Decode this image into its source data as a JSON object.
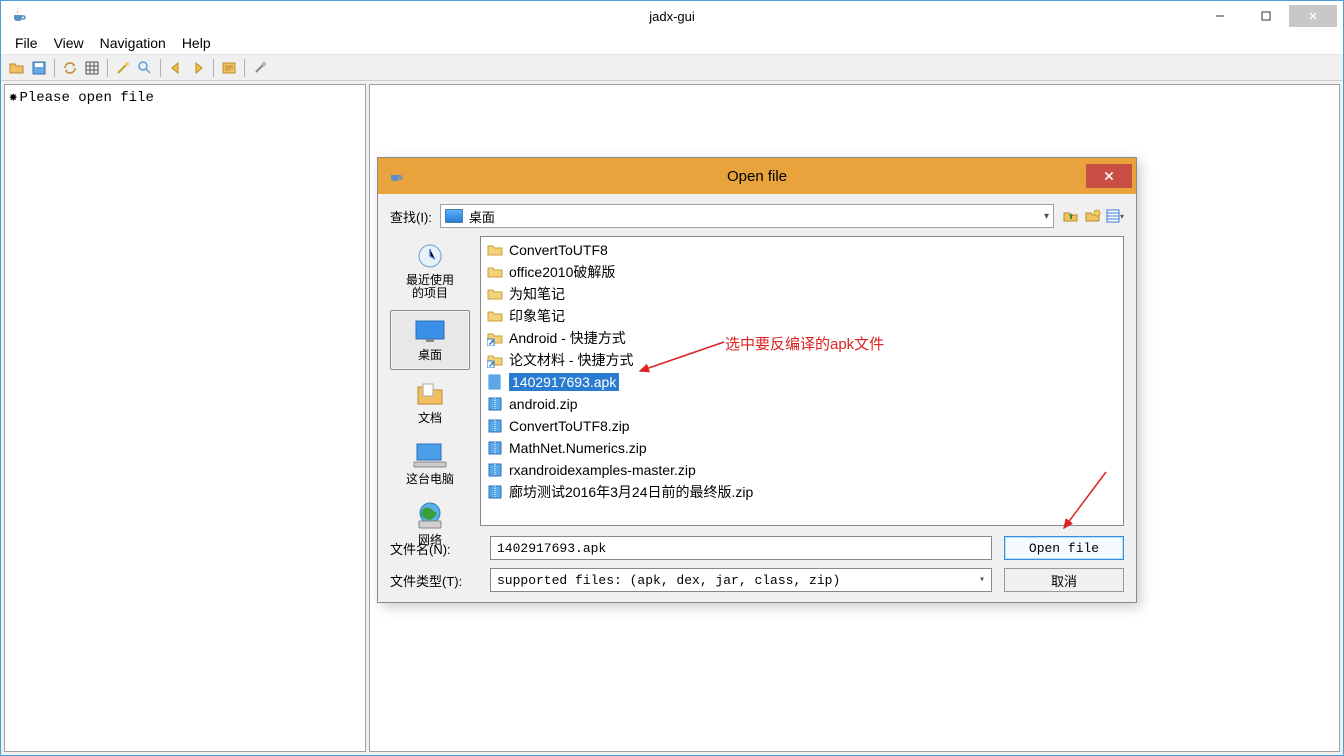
{
  "window": {
    "title": "jadx-gui"
  },
  "menu": {
    "file": "File",
    "view": "View",
    "navigation": "Navigation",
    "help": "Help"
  },
  "sidepanel": {
    "message": "Please open file"
  },
  "dialog": {
    "title": "Open file",
    "lookup_label": "查找(I):",
    "lookup_value": "桌面",
    "places": {
      "recent": "最近使用\n的项目",
      "desktop": "桌面",
      "documents": "文档",
      "computer": "这台电脑",
      "network": "网络"
    },
    "files": [
      {
        "name": "ConvertToUTF8",
        "type": "folder"
      },
      {
        "name": "office2010破解版",
        "type": "folder"
      },
      {
        "name": "为知笔记",
        "type": "folder"
      },
      {
        "name": "印象笔记",
        "type": "folder"
      },
      {
        "name": "Android - 快捷方式",
        "type": "shortcut"
      },
      {
        "name": "论文材料 - 快捷方式",
        "type": "shortcut"
      },
      {
        "name": "1402917693.apk",
        "type": "apk",
        "selected": true
      },
      {
        "name": "android.zip",
        "type": "zip"
      },
      {
        "name": "ConvertToUTF8.zip",
        "type": "zip"
      },
      {
        "name": "MathNet.Numerics.zip",
        "type": "zip"
      },
      {
        "name": "rxandroidexamples-master.zip",
        "type": "zip"
      },
      {
        "name": "廊坊测试2016年3月24日前的最终版.zip",
        "type": "zip"
      }
    ],
    "filename_label": "文件名(N):",
    "filename_value": "1402917693.apk",
    "filetype_label": "文件类型(T):",
    "filetype_value": "supported files: (apk, dex, jar, class, zip)",
    "open_btn": "Open file",
    "cancel_btn": "取消"
  },
  "annotation": {
    "text": "选中要反编译的apk文件"
  }
}
